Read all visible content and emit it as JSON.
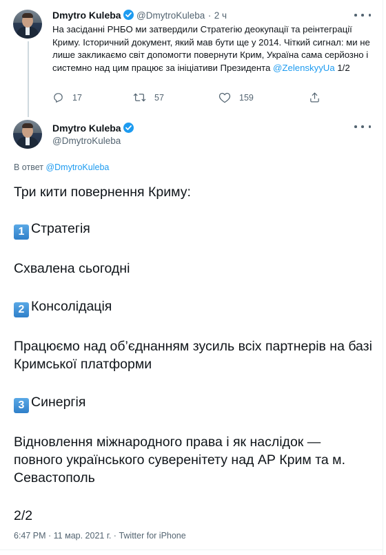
{
  "tweet1": {
    "author_name": "Dmytro Kuleba",
    "author_handle": "@DmytroKuleba",
    "separator": "·",
    "time_ago": "2 ч",
    "text_part": "На засіданні РНБО ми затвердили Стратегію деокупації та реінтеграції Криму. Історичний документ, який мав бути ще у 2014. Чіткий сигнал: ми не лише закликаємо світ допомогти повернути Крим, Україна сама серйозно і системно над цим працює за ініціативи Президента",
    "mention": "@ZelenskyyUa",
    "suffix": " 1/2",
    "replies": "17",
    "retweets": "57",
    "likes": "159"
  },
  "tweet2": {
    "author_name": "Dmytro Kuleba",
    "author_handle": "@DmytroKuleba",
    "reply_prefix": "В ответ ",
    "reply_handle": "@DmytroKuleba",
    "intro": "Три кити повернення Криму:",
    "keycap1": "1",
    "item1_title": "Стратегія",
    "item1_body": "Схвалена сьогодні",
    "keycap2": "2",
    "item2_title": "Консолідація",
    "item2_body": "Працюємо над об’єднанням зусиль всіх партнерів на базі Кримської платформи",
    "keycap3": "3",
    "item3_title": "Синергія",
    "item3_body": "Відновлення міжнародного права і як наслідок — повного українського суверенітету над АР Крим та м. Севастополь",
    "page": "2/2",
    "timestamp": "6:47 PM · 11 мар. 2021 г. · Twitter for iPhone"
  },
  "colors": {
    "accent": "#1d9bf0",
    "text": "#0f1419",
    "secondary": "#536471"
  },
  "icons": [
    "verified-badge-icon",
    "more-icon",
    "reply-icon",
    "retweet-icon",
    "like-icon",
    "share-icon"
  ]
}
